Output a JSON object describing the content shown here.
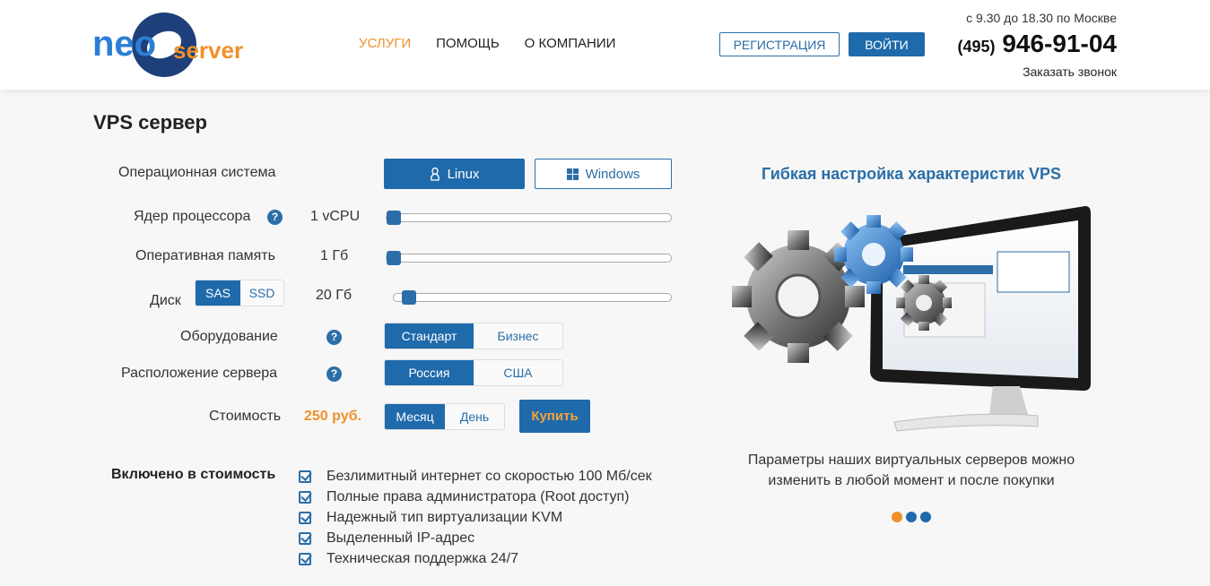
{
  "header": {
    "logo": {
      "part1": "neo",
      "part2": "server"
    },
    "nav": [
      {
        "label": "УСЛУГИ",
        "active": true
      },
      {
        "label": "ПОМОЩЬ",
        "active": false
      },
      {
        "label": "О КОМПАНИИ",
        "active": false
      }
    ],
    "register_label": "РЕГИСТРАЦИЯ",
    "login_label": "ВОЙТИ",
    "hours": "с 9.30 до 18.30 по Москве",
    "phone_code": "(495)",
    "phone_number": "946-91-04",
    "callback_label": "Заказать звонок"
  },
  "config": {
    "title": "VPS сервер",
    "os_label": "Операционная система",
    "os_options": [
      "Linux",
      "Windows"
    ],
    "os_selected": "Linux",
    "cpu_label": "Ядер процессора",
    "cpu_value": "1 vCPU",
    "cpu_level": 0.0,
    "ram_label": "Оперативная память",
    "ram_value": "1 Гб",
    "ram_level": 0.0,
    "disk_label": "Диск",
    "disk_types": [
      "SAS",
      "SSD"
    ],
    "disk_type_selected": "SAS",
    "disk_value": "20 Гб",
    "disk_level": 0.03,
    "hardware_label": "Оборудование",
    "hardware_options": [
      "Стандарт",
      "Бизнес"
    ],
    "hardware_selected": "Стандарт",
    "location_label": "Расположение сервера",
    "location_options": [
      "Россия",
      "США"
    ],
    "location_selected": "Россия",
    "cost_label": "Стоимость",
    "price": "250 руб.",
    "period_options": [
      "Месяц",
      "День"
    ],
    "period_selected": "Месяц",
    "buy_label": "Купить",
    "help_glyph": "?"
  },
  "included": {
    "title": "Включено в стоимость",
    "items": [
      "Безлимитный интернет со скоростью 100 Мб/сек",
      "Полные права администратора (Root доступ)",
      "Надежный тип виртуализации KVM",
      "Выделенный IP-адрес",
      "Техническая поддержка 24/7"
    ]
  },
  "promo": {
    "title": "Гибкая настройка характеристик VPS",
    "text_line1": "Параметры наших виртуальных серверов можно",
    "text_line2": "изменить в любой момент и после покупки",
    "slides": 3,
    "active_slide": 0
  },
  "colors": {
    "accent": "#1f6aab",
    "orange": "#f0902a",
    "background": "#f7f7f7"
  }
}
